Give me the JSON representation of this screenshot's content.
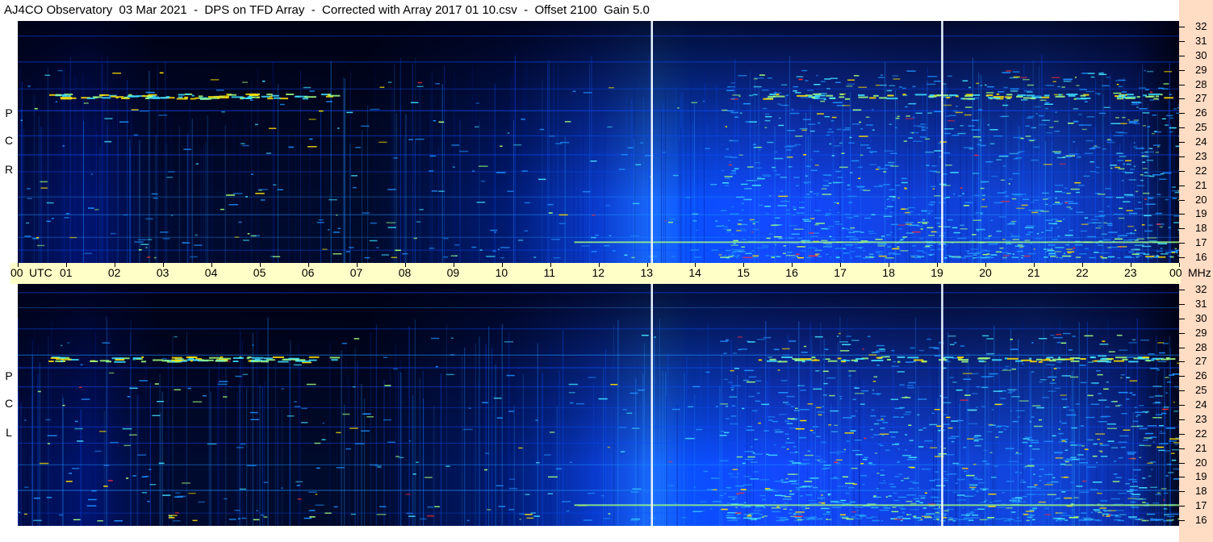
{
  "title": "AJ4CO Observatory  03 Mar 2021  -  DPS on TFD Array  -  Corrected with Array 2017 01 10.csv  -  Offset 2100  Gain 5.0",
  "chart_data": {
    "type": "heatmap",
    "title": "AJ4CO Observatory  03 Mar 2021  -  DPS on TFD Array  -  Corrected with Array 2017 01 10.csv  -  Offset 2100  Gain 5.0",
    "xlabel": "UTC",
    "ylabel": "MHz",
    "xlim": [
      0,
      24
    ],
    "ylim": [
      16,
      32
    ],
    "x_ticks": [
      "00",
      "01",
      "02",
      "03",
      "04",
      "05",
      "06",
      "07",
      "08",
      "09",
      "10",
      "11",
      "12",
      "13",
      "14",
      "15",
      "16",
      "17",
      "18",
      "19",
      "20",
      "21",
      "22",
      "23",
      "00"
    ],
    "y_ticks": [
      "16",
      "17",
      "18",
      "19",
      "20",
      "21",
      "22",
      "23",
      "24",
      "25",
      "26",
      "27",
      "28",
      "29",
      "30",
      "31",
      "32"
    ],
    "x_axis_unit": "UTC",
    "y_axis_unit": "MHz",
    "colormap": [
      "#000010",
      "#001a8c",
      "#0a4cff",
      "#1e90ff",
      "#40e0ff",
      "#a0ff80",
      "#ffe000",
      "#ff3030"
    ],
    "panels": [
      {
        "name": "R C P",
        "letters": [
          "R",
          "C",
          "P"
        ]
      },
      {
        "name": "L C P",
        "letters": [
          "L",
          "C",
          "P"
        ]
      }
    ],
    "markers_utc": [
      13.1,
      19.1
    ],
    "marker_color": "#e8f4ff",
    "grid": false
  }
}
